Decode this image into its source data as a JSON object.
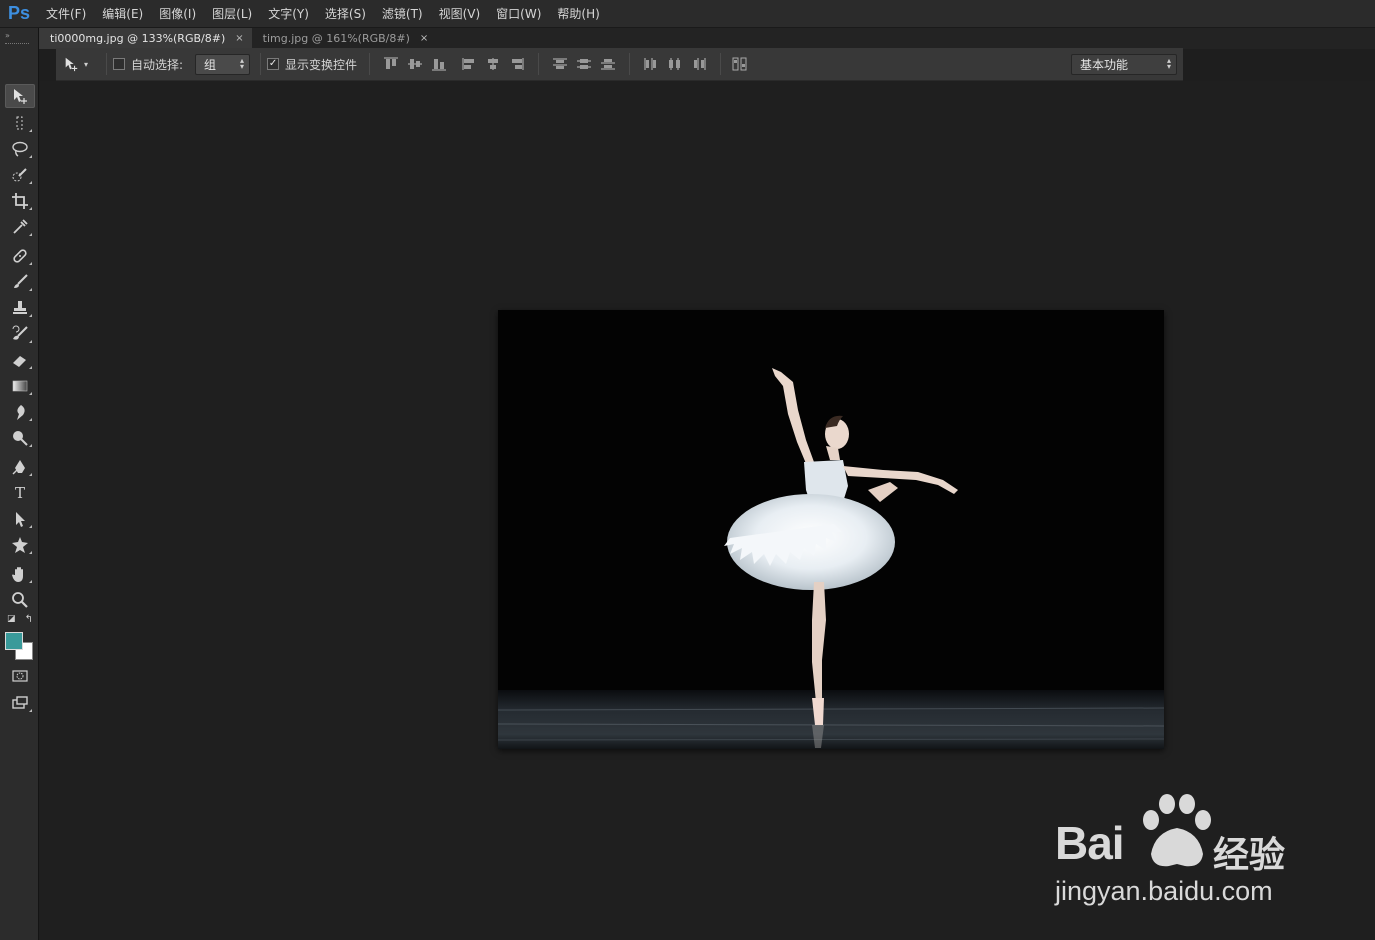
{
  "app": {
    "logo": "Ps",
    "accent_color": "#3d8fe0"
  },
  "menu": [
    "文件(F)",
    "编辑(E)",
    "图像(I)",
    "图层(L)",
    "文字(Y)",
    "选择(S)",
    "滤镜(T)",
    "视图(V)",
    "窗口(W)",
    "帮助(H)"
  ],
  "tabs": [
    {
      "label": "ti0000mg.jpg @ 133%(RGB/8#)",
      "close": "×",
      "active": true
    },
    {
      "label": "timg.jpg @ 161%(RGB/8#)",
      "close": "×",
      "active": false
    }
  ],
  "options": {
    "auto_select_label": "自动选择:",
    "auto_select_checked": false,
    "auto_select_value": "组",
    "show_transform_label": "显示变换控件",
    "show_transform_checked": true,
    "workspace_value": "基本功能"
  },
  "tools": [
    "move-tool",
    "marquee-tool",
    "lasso-tool",
    "quick-selection-tool",
    "crop-tool",
    "eyedropper-tool",
    "healing-brush-tool",
    "brush-tool",
    "clone-stamp-tool",
    "history-brush-tool",
    "eraser-tool",
    "gradient-tool",
    "blur-tool",
    "dodge-tool",
    "pen-tool",
    "type-tool",
    "path-selection-tool",
    "custom-shape-tool",
    "hand-tool",
    "zoom-tool",
    "quick-mask-tool",
    "screen-mode-tool"
  ],
  "type_tool_glyph": "T",
  "colors": {
    "foreground": "#3a9a9a",
    "background": "#ffffff"
  },
  "watermark": {
    "brand": "Bai",
    "brand_suffix": "经验",
    "url": "jingyan.baidu.com"
  }
}
